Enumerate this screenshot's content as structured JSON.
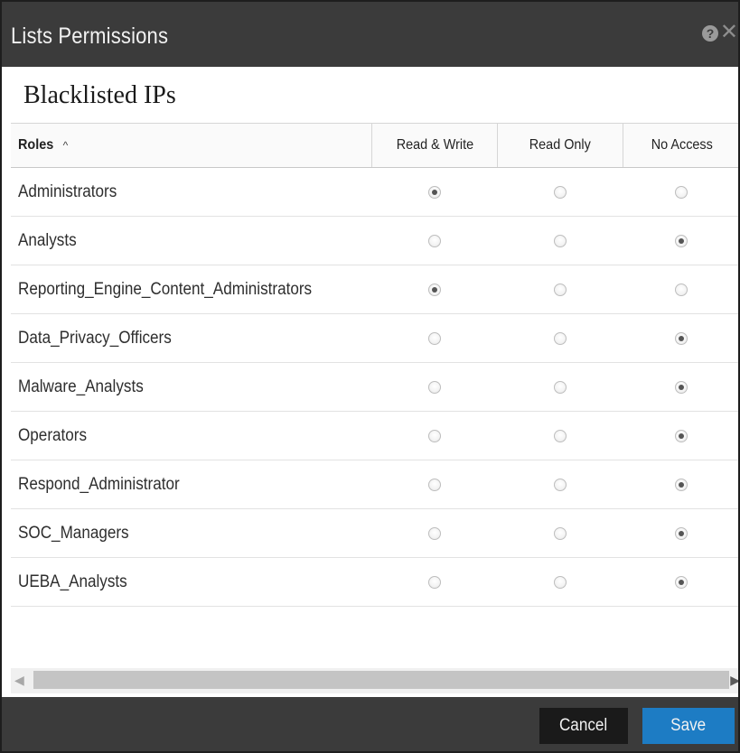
{
  "dialog": {
    "title": "Lists Permissions",
    "help_icon": "question-circle-icon",
    "close_icon": "close-icon",
    "list_name": "Blacklisted IPs"
  },
  "table": {
    "headers": {
      "role": "Roles",
      "role_sort": "^",
      "read_write": "Read & Write",
      "read_only": "Read Only",
      "no_access": "No Access"
    },
    "rows": [
      {
        "role": "Administrators",
        "permission": "Read & Write"
      },
      {
        "role": "Analysts",
        "permission": "No Access"
      },
      {
        "role": "Reporting_Engine_Content_Administrators",
        "permission": "Read & Write"
      },
      {
        "role": "Data_Privacy_Officers",
        "permission": "No Access"
      },
      {
        "role": "Malware_Analysts",
        "permission": "No Access"
      },
      {
        "role": "Operators",
        "permission": "No Access"
      },
      {
        "role": "Respond_Administrator",
        "permission": "No Access"
      },
      {
        "role": "SOC_Managers",
        "permission": "No Access"
      },
      {
        "role": "UEBA_Analysts",
        "permission": "No Access"
      }
    ]
  },
  "footer": {
    "cancel_label": "Cancel",
    "save_label": "Save"
  },
  "colors": {
    "titlebar": "#3b3b3b",
    "save_button": "#1d7cc4",
    "cancel_button": "#1a1a1a"
  }
}
